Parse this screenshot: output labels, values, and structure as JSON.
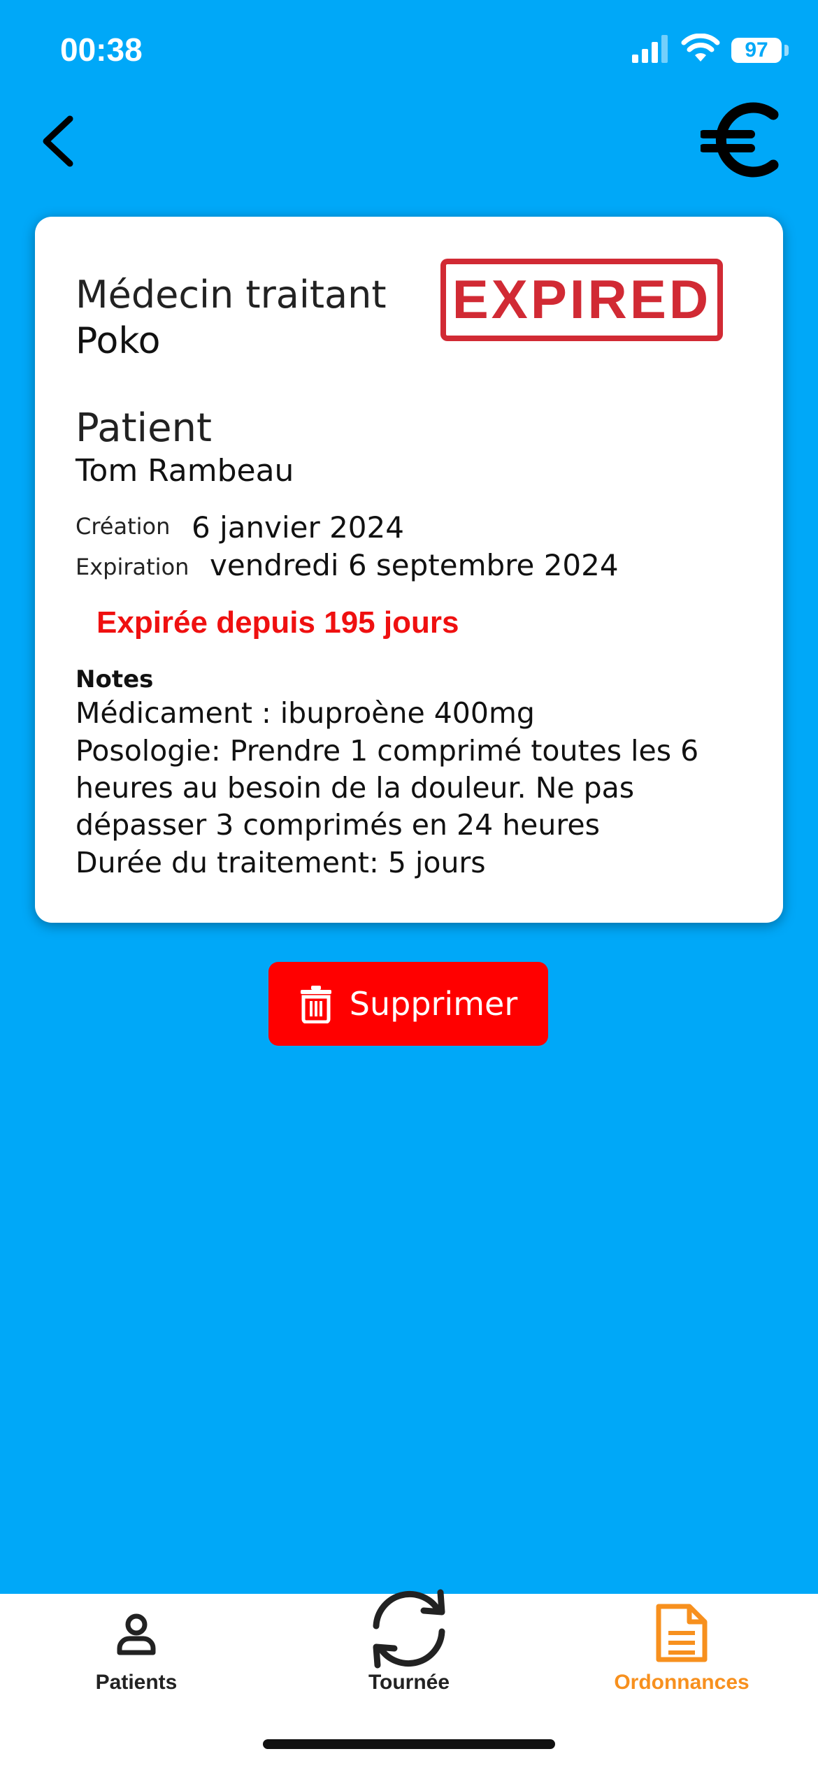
{
  "status_bar": {
    "time": "00:38",
    "battery": "97"
  },
  "header": {
    "back_icon": "chevron-left-icon",
    "currency_icon": "euro-icon"
  },
  "prescription": {
    "doctor_label": "Médecin traitant",
    "doctor_name": "Poko",
    "stamp_text": "EXPIRED",
    "patient_label": "Patient",
    "patient_name": "Tom  Rambeau",
    "creation_label": "Création",
    "creation_value": "6  janvier 2024",
    "expiration_label": "Expiration",
    "expiration_value": "vendredi 6 septembre 2024",
    "expired_message": "Expirée depuis 195 jours",
    "notes_label": "Notes",
    "notes_lines": [
      "Médicament : ibuproène 400mg",
      "Posologie: Prendre 1 comprimé toutes les 6",
      "heures au besoin de la douleur. Ne pas",
      "dépasser 3 comprimés en 24 heures",
      "Durée du traitement: 5 jours"
    ]
  },
  "actions": {
    "delete_label": "Supprimer"
  },
  "tabs": [
    {
      "label": "Patients",
      "icon": "person-icon",
      "active": false
    },
    {
      "label": "Tournée",
      "icon": "refresh-cycle-icon",
      "active": false
    },
    {
      "label": "Ordonnances",
      "icon": "document-icon",
      "active": true
    }
  ],
  "colors": {
    "background": "#00a8f8",
    "stamp": "#d12a34",
    "expired_text": "#ef1010",
    "delete_button": "#ff0000",
    "active_tab": "#f7901e",
    "inactive_tab": "#222222"
  }
}
